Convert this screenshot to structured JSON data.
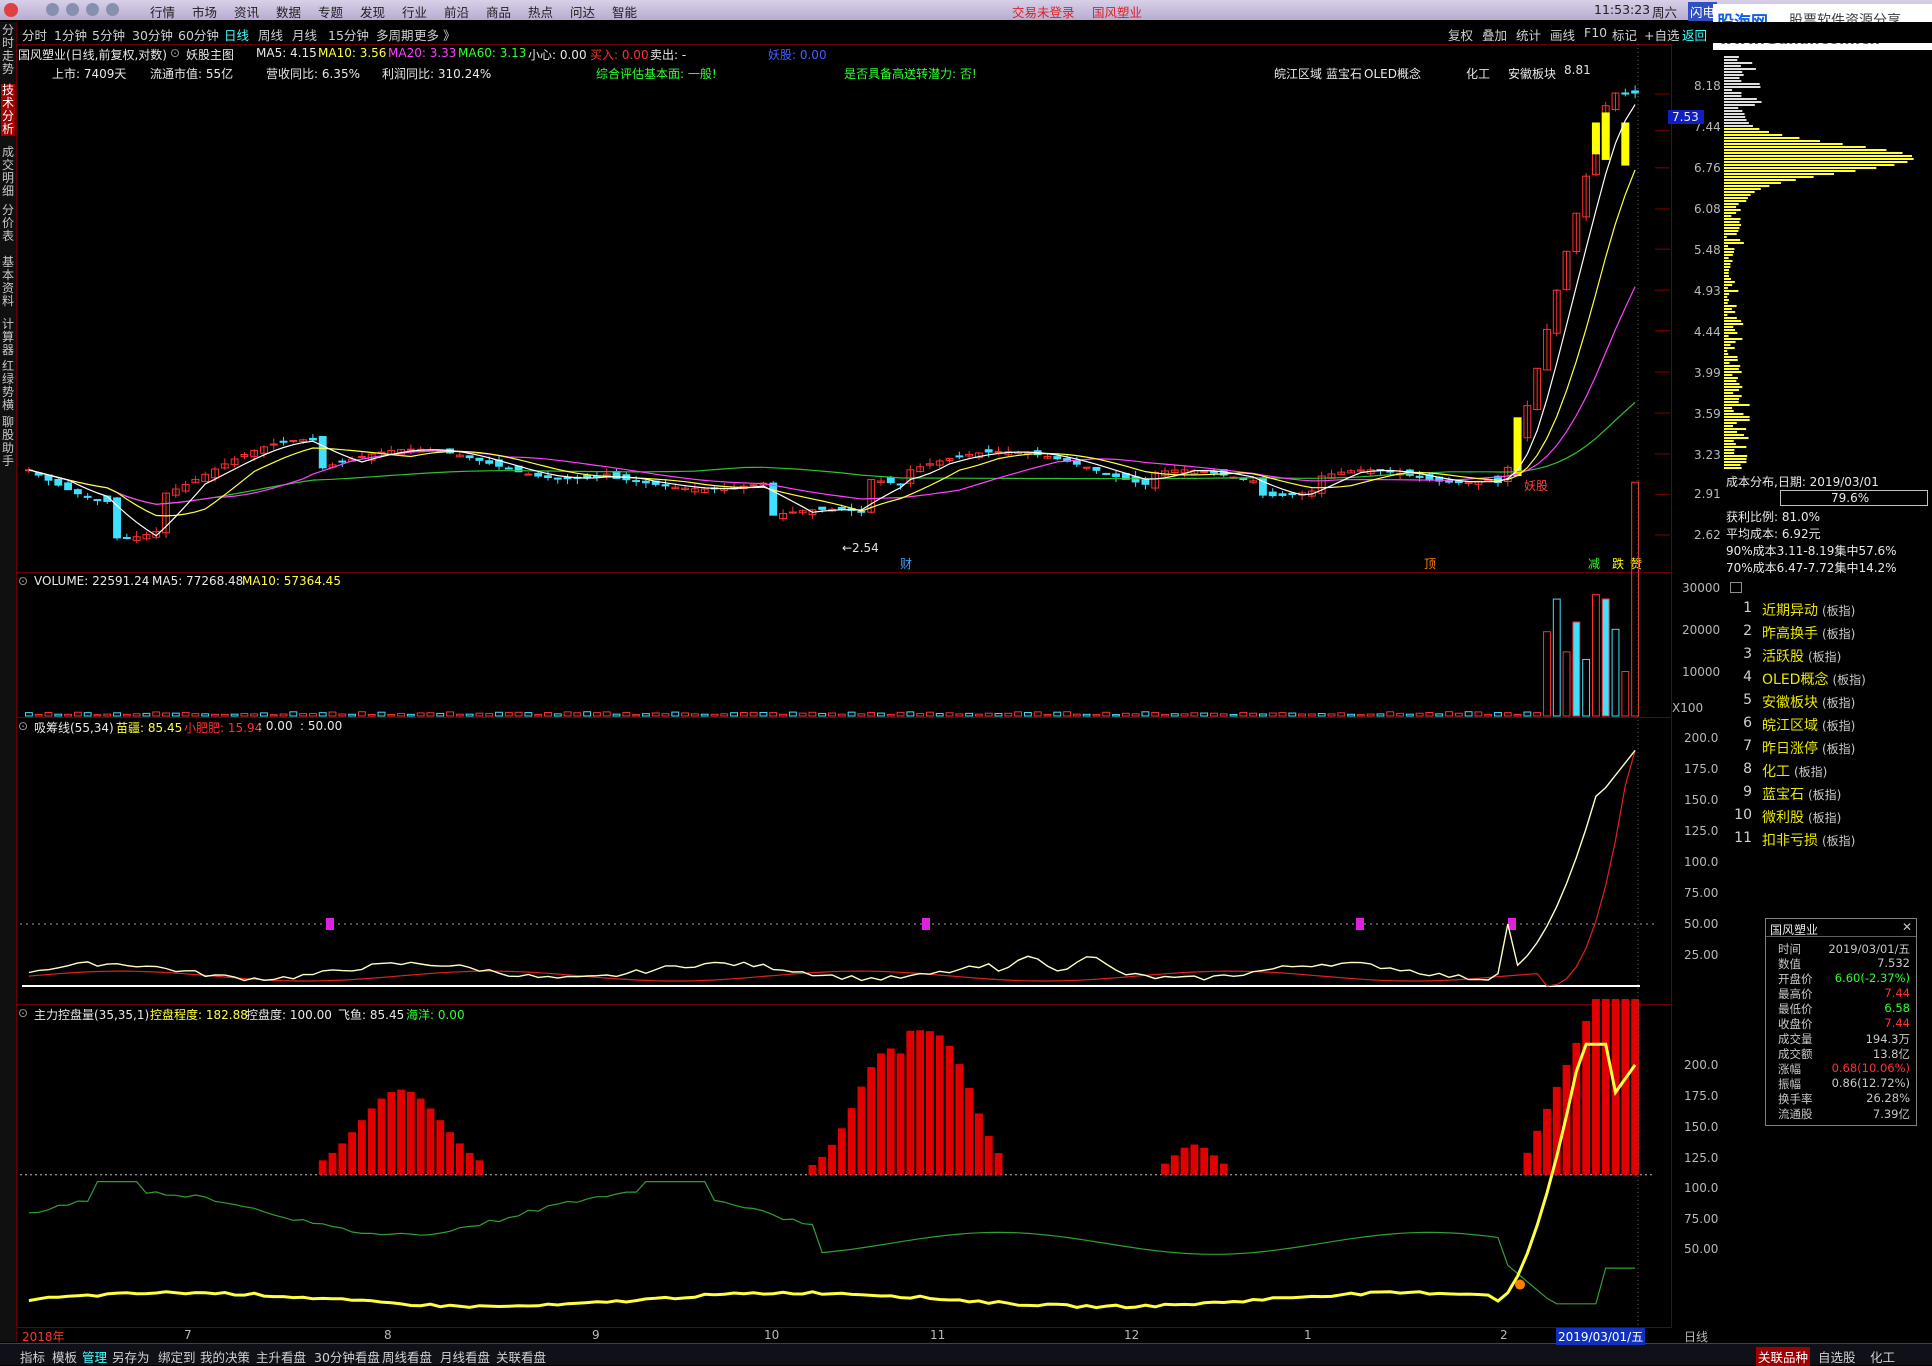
{
  "titlebar": {
    "menus": [
      "行情",
      "市场",
      "资讯",
      "数据",
      "专题",
      "发现",
      "行业",
      "前沿",
      "商品",
      "热点",
      "问达",
      "智能"
    ],
    "login_status": "交易未登录",
    "stock_title": "国风塑业",
    "clock": "11:53:23",
    "weekday": "周六",
    "flash_label": "闪电",
    "watermark_brand": "股海网",
    "watermark_slogan": "股票软件资源分享",
    "watermark_url": "www.Guhai.com.cn"
  },
  "period_tabs": [
    "分时",
    "1分钟",
    "5分钟",
    "30分钟",
    "60分钟",
    "日线",
    "周线",
    "月线",
    "15分钟",
    "多周期",
    "更多 》"
  ],
  "active_period": "日线",
  "toolbar_right": [
    "复权",
    "叠加",
    "统计",
    "画线",
    "F10",
    "标记",
    "+自选",
    "返回"
  ],
  "left_tabs": [
    "分时走势",
    "技术分析",
    "成交明细",
    "分价表",
    "基本资料",
    "计算器",
    "红绿势横",
    "聊股助手"
  ],
  "main_header": {
    "name": "国风塑业(日线,前复权,对数)",
    "formula": "妖股主图",
    "ma5": "MA5: 4.15",
    "ma10": "MA10: 3.56",
    "ma20": "MA20: 3.33",
    "ma60": "MA60: 3.13",
    "xin": "小心: 0.00",
    "buy": "买入: 0.00",
    "sell": "卖出: -",
    "yao": "妖股: 0.00"
  },
  "main_info": {
    "listed": "上市: 7409天",
    "float_mv": "流通市值: 55亿",
    "rev_yoy": "营收同比: 6.35%",
    "profit_yoy": "利润同比: 310.24%",
    "fundamental": "综合评估基本面: 一般!",
    "potential": "是否具备高送转潜力: 否!",
    "concepts": [
      "皖江区域",
      "蓝宝石",
      "OLED概念",
      "化工",
      "安徽板块"
    ]
  },
  "price_axis": [
    "8.18",
    "7.44",
    "6.76",
    "6.08",
    "5.48",
    "4.93",
    "4.44",
    "3.99",
    "3.59",
    "3.23",
    "2.91",
    "2.62"
  ],
  "last_price": "7.53",
  "high_label": "8.81",
  "low_label": "←2.54",
  "yao_label": "妖股",
  "main_markers": [
    "财",
    "顶",
    "减",
    "跌",
    "赞"
  ],
  "chip": {
    "date": "成本分布,日期: 2019/03/01",
    "ratio": "79.6%",
    "profit": "获利比例: 81.0%",
    "avg": "平均成本: 6.92元",
    "c90": "90%成本3.11-8.19集中57.6%",
    "c70": "70%成本6.47-7.72集中14.2%"
  },
  "volume_header": {
    "label": "VOLUME: 22591.24",
    "ma5": "MA5: 77268.48",
    "ma10": "MA10: 57364.45"
  },
  "volume_axis": [
    "30000",
    "20000",
    "10000",
    "X100"
  ],
  "xichou_header": {
    "label": "吸筹线(55,34)",
    "a": "苗疆: 85.45",
    "b": "小肥肥: 15.94",
    "c": ": 0.00",
    "d": ": 50.00"
  },
  "xichou_axis": [
    "200.0",
    "175.0",
    "150.0",
    "125.0",
    "100.0",
    "75.00",
    "50.00",
    "25.00"
  ],
  "kongpan_header": {
    "label": "主力控盘量(35,35,1)",
    "a": "控盘程度: 182.88",
    "b": "控盘度: 100.00",
    "c": "飞鱼: 85.45",
    "d": "海洋: 0.00"
  },
  "kongpan_axis": [
    "200.0",
    "175.0",
    "150.0",
    "125.0",
    "100.0",
    "75.00",
    "50.00"
  ],
  "date_axis": [
    "2018年",
    "7",
    "8",
    "9",
    "10",
    "11",
    "12",
    "1",
    "2",
    "2019/03/01/五",
    "日线"
  ],
  "right_list": [
    {
      "n": "1",
      "name": "近期异动",
      "tag": "(板指)"
    },
    {
      "n": "2",
      "name": "昨高换手",
      "tag": "(板指)"
    },
    {
      "n": "3",
      "name": "活跃股",
      "tag": "(板指)"
    },
    {
      "n": "4",
      "name": "OLED概念",
      "tag": "(板指)"
    },
    {
      "n": "5",
      "name": "安徽板块",
      "tag": "(板指)"
    },
    {
      "n": "6",
      "name": "皖江区域",
      "tag": "(板指)"
    },
    {
      "n": "7",
      "name": "昨日涨停",
      "tag": "(板指)"
    },
    {
      "n": "8",
      "name": "化工",
      "tag": "(板指)"
    },
    {
      "n": "9",
      "name": "蓝宝石",
      "tag": "(板指)"
    },
    {
      "n": "10",
      "name": "微利股",
      "tag": "(板指)"
    },
    {
      "n": "11",
      "name": "扣非亏损",
      "tag": "(板指)"
    }
  ],
  "infobox": {
    "title": "国风塑业",
    "rows": [
      {
        "k": "时间",
        "v": "2019/03/01/五",
        "c": "#c8c8c8"
      },
      {
        "k": "数值",
        "v": "7.532",
        "c": "#c8c8c8"
      },
      {
        "k": "开盘价",
        "v": "6.60(-2.37%)",
        "c": "#30ff30"
      },
      {
        "k": "最高价",
        "v": "7.44",
        "c": "#ff3030"
      },
      {
        "k": "最低价",
        "v": "6.58",
        "c": "#30ff30"
      },
      {
        "k": "收盘价",
        "v": "7.44",
        "c": "#ff3030"
      },
      {
        "k": "成交量",
        "v": "194.3万",
        "c": "#c8c8c8"
      },
      {
        "k": "成交额",
        "v": "13.8亿",
        "c": "#c8c8c8"
      },
      {
        "k": "涨幅",
        "v": "0.68(10.06%)",
        "c": "#ff3030"
      },
      {
        "k": "振幅",
        "v": "0.86(12.72%)",
        "c": "#c8c8c8"
      },
      {
        "k": "换手率",
        "v": "26.28%",
        "c": "#c8c8c8"
      },
      {
        "k": "流通股",
        "v": "7.39亿",
        "c": "#c8c8c8"
      }
    ]
  },
  "bottom_tabs": [
    "指标",
    "模板",
    "管理",
    "另存为",
    "绑定到",
    "我的决策",
    "主升看盘",
    "30分钟看盘",
    "周线看盘",
    "月线看盘",
    "关联看盘"
  ],
  "bottom_right": [
    "关联品种",
    "自选股",
    "化工"
  ],
  "colors": {
    "up": "#ff3030",
    "down": "#40e0ff",
    "ma5": "#ffffff",
    "ma10": "#ffff40",
    "ma20": "#ff40ff",
    "ma60": "#30c030",
    "bar": "#e00000"
  }
}
